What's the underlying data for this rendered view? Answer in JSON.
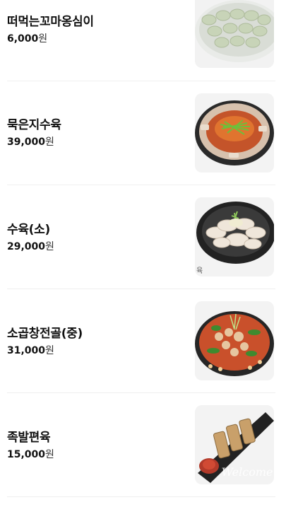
{
  "menu": {
    "items": [
      {
        "name": "떠먹는꼬마옹심이",
        "price": "6,000",
        "unit": "원",
        "photo": "dumpling-dish-photo"
      },
      {
        "name": "묵은지수육",
        "price": "39,000",
        "unit": "원",
        "photo": "kimchi-pork-stew-photo"
      },
      {
        "name": "수육(소)",
        "price": "29,000",
        "unit": "원",
        "photo": "boiled-pork-platter-photo",
        "caption": "육"
      },
      {
        "name": "소곱창전골(중)",
        "price": "31,000",
        "unit": "원",
        "photo": "beef-tripe-hotpot-photo"
      },
      {
        "name": "족발편육",
        "price": "15,000",
        "unit": "원",
        "photo": "pork-trotter-slices-photo",
        "watermark": "Welcome"
      }
    ]
  },
  "colors": {
    "text": "#111111",
    "divider": "#efefef",
    "thumb_background": "#f4f4f4"
  }
}
